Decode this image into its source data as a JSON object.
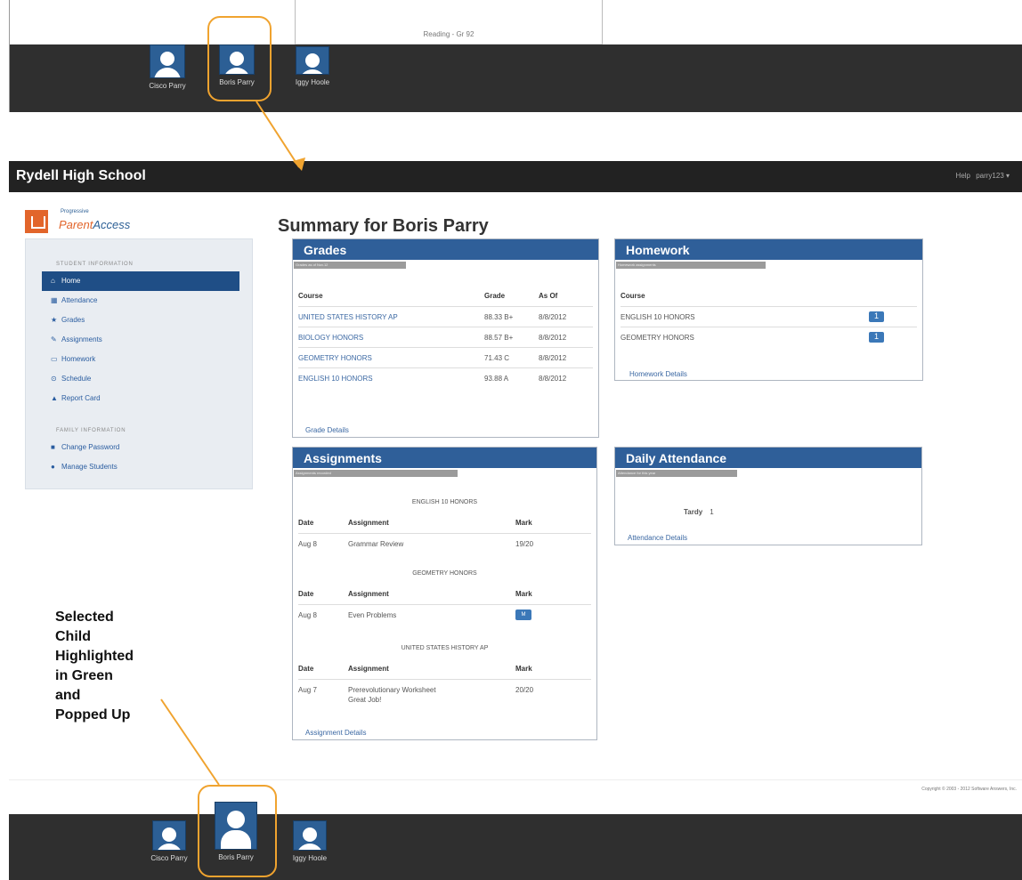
{
  "top_crop": {
    "cell_text": "Reading - Gr 92"
  },
  "top_dock": {
    "children": [
      {
        "name": "Cisco Parry"
      },
      {
        "name": "Boris Parry"
      },
      {
        "name": "Iggy Hoole"
      }
    ]
  },
  "app": {
    "school": "Rydell High School",
    "help": "Help",
    "user": "parry123 ▾"
  },
  "brand": {
    "small": "Progressive",
    "parent": "Parent",
    "access": "Access"
  },
  "sidebar": {
    "section_student": "STUDENT INFORMATION",
    "section_family": "FAMILY INFORMATION",
    "items": [
      {
        "label": "Home",
        "icon": "home-icon",
        "glyph": "⌂",
        "active": true
      },
      {
        "label": "Attendance",
        "icon": "calendar-icon",
        "glyph": "▦"
      },
      {
        "label": "Grades",
        "icon": "star-icon",
        "glyph": "★"
      },
      {
        "label": "Assignments",
        "icon": "pencil-icon",
        "glyph": "✎"
      },
      {
        "label": "Homework",
        "icon": "book-icon",
        "glyph": "▭"
      },
      {
        "label": "Schedule",
        "icon": "clock-icon",
        "glyph": "⊙"
      },
      {
        "label": "Report Card",
        "icon": "report-card-icon",
        "glyph": "▲"
      }
    ],
    "family_items": [
      {
        "label": "Change Password",
        "icon": "lock-icon",
        "glyph": "■"
      },
      {
        "label": "Manage Students",
        "icon": "user-icon",
        "glyph": "●"
      }
    ]
  },
  "main": {
    "title": "Summary for Boris Parry"
  },
  "grades": {
    "title": "Grades",
    "meta": "Grades as of Nov.12",
    "headers": {
      "course": "Course",
      "grade": "Grade",
      "as_of": "As Of"
    },
    "rows": [
      {
        "course": "UNITED STATES HISTORY AP",
        "grade": "88.33 B+",
        "as_of": "8/8/2012"
      },
      {
        "course": "BIOLOGY HONORS",
        "grade": "88.57 B+",
        "as_of": "8/8/2012"
      },
      {
        "course": "GEOMETRY HONORS",
        "grade": "71.43 C",
        "as_of": "8/8/2012"
      },
      {
        "course": "ENGLISH 10 HONORS",
        "grade": "93.88 A",
        "as_of": "8/8/2012"
      }
    ],
    "details": "Grade Details"
  },
  "homework": {
    "title": "Homework",
    "meta": "Homework assignments",
    "headers": {
      "course": "Course"
    },
    "rows": [
      {
        "course": "ENGLISH 10 HONORS",
        "badge": "1"
      },
      {
        "course": "GEOMETRY HONORS",
        "badge": "1"
      }
    ],
    "details": "Homework Details"
  },
  "assignments": {
    "title": "Assignments",
    "meta": "Assignments recorded",
    "headers": {
      "date": "Date",
      "assignment": "Assignment",
      "mark": "Mark"
    },
    "groups": [
      {
        "course": "ENGLISH 10 HONORS",
        "row": {
          "date": "Aug 8",
          "assignment": "Grammar Review",
          "mark": "19/20"
        }
      },
      {
        "course": "GEOMETRY HONORS",
        "row": {
          "date": "Aug 8",
          "assignment": "Even Problems",
          "mark": "M"
        }
      },
      {
        "course": "UNITED STATES HISTORY AP",
        "row": {
          "date": "Aug 7",
          "assignment": "Prerevolutionary Worksheet",
          "note": "Great Job!",
          "mark": "20/20"
        }
      }
    ],
    "details": "Assignment Details"
  },
  "attendance": {
    "title": "Daily Attendance",
    "meta": "Attendance for this year",
    "tardy_label": "Tardy",
    "tardy_count": "1",
    "details": "Attendance Details"
  },
  "footer": {
    "copyright": "Copyright © 2003 - 2012 Software Answers, Inc."
  },
  "annotation": {
    "text": "Selected Child Highlighted in Green and Popped Up",
    "lines": [
      "Selected",
      "Child",
      "Highlighted",
      "in Green",
      "and",
      "Popped Up"
    ]
  },
  "bottom_dock": {
    "children": [
      {
        "name": "Cisco Parry"
      },
      {
        "name": "Boris Parry"
      },
      {
        "name": "Iggy Hoole"
      }
    ]
  },
  "colors": {
    "dock": "#2f2f2f",
    "brand_orange": "#e2652b",
    "brand_blue": "#2f5f99",
    "selection": "#f0a32f"
  }
}
